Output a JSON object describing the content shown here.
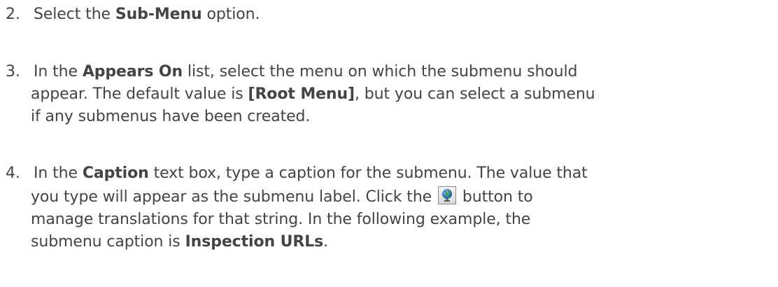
{
  "steps": [
    {
      "number": "2.",
      "lines": [
        [
          {
            "text": "Select the ",
            "bold": false
          },
          {
            "text": "Sub-Menu",
            "bold": true
          },
          {
            "text": " option.",
            "bold": false
          }
        ]
      ]
    },
    {
      "number": "3.",
      "lines": [
        [
          {
            "text": "In the ",
            "bold": false
          },
          {
            "text": "Appears On",
            "bold": true
          },
          {
            "text": " list, select the menu on which the submenu should",
            "bold": false
          }
        ],
        [
          {
            "text": "appear. The default value is ",
            "bold": false
          },
          {
            "text": "[Root Menu]",
            "bold": true
          },
          {
            "text": ", but you can select a submenu",
            "bold": false
          }
        ],
        [
          {
            "text": "if any submenus have been created.",
            "bold": false
          }
        ]
      ]
    },
    {
      "number": "4.",
      "lines": [
        [
          {
            "text": "In the ",
            "bold": false
          },
          {
            "text": "Caption",
            "bold": true
          },
          {
            "text": " text box, type a caption for the submenu. The value that",
            "bold": false
          }
        ],
        [
          {
            "text": "you type will appear as the submenu label.  Click the ",
            "bold": false
          },
          {
            "icon": "globe-translate-icon"
          },
          {
            "text": " button to",
            "bold": false
          }
        ],
        [
          {
            "text": "manage translations for that string. In the following example, the",
            "bold": false
          }
        ],
        [
          {
            "text": "submenu caption is ",
            "bold": false
          },
          {
            "text": "Inspection URLs",
            "bold": true
          },
          {
            "text": ".",
            "bold": false
          }
        ]
      ]
    }
  ]
}
